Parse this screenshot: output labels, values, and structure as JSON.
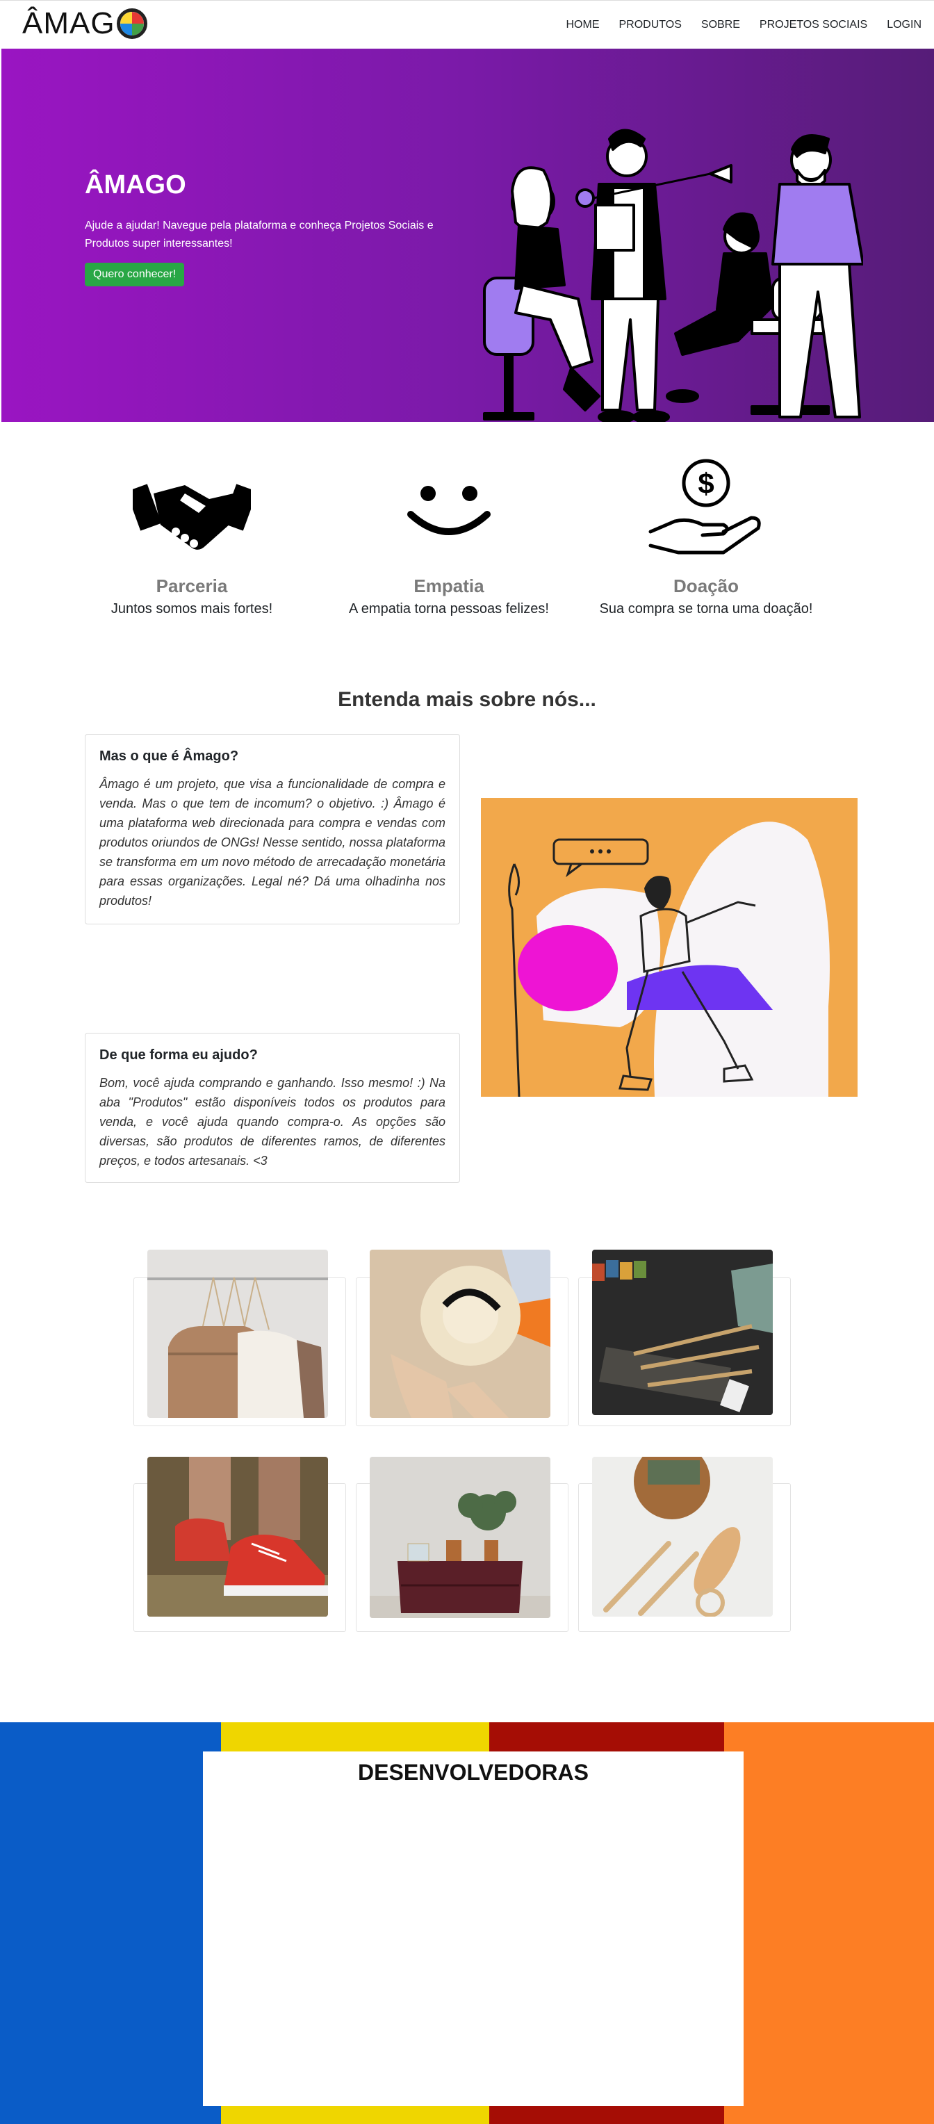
{
  "brand": {
    "name": "ÂMAGO",
    "logo_text": "ÂMAG"
  },
  "nav": {
    "items": [
      "HOME",
      "PRODUTOS",
      "SOBRE",
      "PROJETOS SOCIAIS",
      "LOGIN"
    ]
  },
  "hero": {
    "title": "ÂMAGO",
    "subtitle": "Ajude a ajudar! Navegue pela plataforma e conheça Projetos Sociais e Produtos super interessantes!",
    "cta": "Quero conhecer!"
  },
  "features": [
    {
      "icon": "handshake-icon",
      "title": "Parceria",
      "subtitle": "Juntos somos mais fortes!"
    },
    {
      "icon": "smile-icon",
      "title": "Empatia",
      "subtitle": "A empatia torna pessoas felizes!"
    },
    {
      "icon": "donation-hand-icon",
      "title": "Doação",
      "subtitle": "Sua compra se torna uma doação!"
    }
  ],
  "about": {
    "heading": "Entenda mais sobre nós...",
    "cards": [
      {
        "title": "Mas o que é Âmago?",
        "text": "Âmago é um projeto, que visa a funcionalidade de compra e venda. Mas o que tem de incomum? o objetivo. :) Âmago é uma plataforma web direcionada para compra e vendas com produtos oriundos de ONGs! Nesse sentido, nossa plataforma se transforma em um novo método de arrecadação monetária para essas organizações. Legal né? Dá uma olhadinha nos produtos!"
      },
      {
        "title": "De que forma eu ajudo?",
        "text": "Bom, você ajuda comprando e ganhando. Isso mesmo! :) Na aba \"Produtos\" estão disponíveis todos os produtos para venda, e você ajuda quando compra-o. As opções são diversas, são produtos de diferentes ramos, de diferentes preços, e todos artesanais. <3"
      }
    ]
  },
  "products": [
    {
      "name": "sweaters-on-hangers"
    },
    {
      "name": "straw-hat"
    },
    {
      "name": "paint-brushes"
    },
    {
      "name": "red-sneakers"
    },
    {
      "name": "wooden-dresser-decor"
    },
    {
      "name": "bamboo-toothbrushes-soap"
    }
  ],
  "footer": {
    "title": "DESENVOLVEDORAS",
    "stripe_colors": [
      "#0a5cc7",
      "#efd600",
      "#a50d05",
      "#fd7e24"
    ]
  },
  "colors": {
    "hero_start": "#9a15c2",
    "hero_end": "#561c78",
    "cta": "#28a745"
  }
}
